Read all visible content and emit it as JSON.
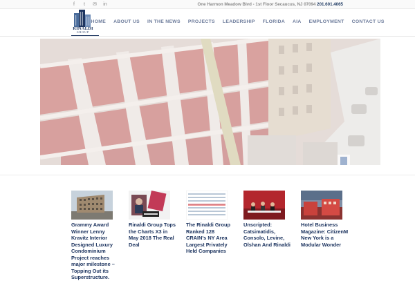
{
  "topbar": {
    "social": [
      {
        "icon": "facebook-icon",
        "glyph": "f"
      },
      {
        "icon": "twitter-icon",
        "glyph": "t"
      },
      {
        "icon": "mail-icon",
        "glyph": "✉"
      },
      {
        "icon": "linkedin-icon",
        "glyph": "in"
      }
    ],
    "address": "One Harmon Meadow Blvd - 1st Floor Secaucus, NJ 07094",
    "phone": "201.601.4065"
  },
  "header": {
    "logo_name": "RINALDI",
    "logo_sub": "GROUP",
    "nav": [
      {
        "label": "HOME",
        "name": "nav-home"
      },
      {
        "label": "ABOUT US",
        "name": "nav-about-us"
      },
      {
        "label": "IN THE NEWS",
        "name": "nav-in-the-news"
      },
      {
        "label": "PROJECTS",
        "name": "nav-projects"
      },
      {
        "label": "LEADERSHIP",
        "name": "nav-leadership"
      },
      {
        "label": "FLORIDA",
        "name": "nav-florida"
      },
      {
        "label": "AIA",
        "name": "nav-aia"
      },
      {
        "label": "EMPLOYMENT",
        "name": "nav-employment"
      },
      {
        "label": "CONTACT US",
        "name": "nav-contact-us"
      }
    ]
  },
  "news": [
    {
      "title": "Grammy Award Winner Lenny Kravitz Interior Designed Luxury Condominium Project reaches major milestone – Topping Out its Superstructure.",
      "thumb": "building-photo"
    },
    {
      "title": "Rinaldi Group Tops the Charts X3 in May 2018 The Real Deal",
      "thumb": "magazine-photo"
    },
    {
      "title": "The Rinaldi Group Ranked 128 CRAIN's NY Area Largest Privately Held Companies",
      "thumb": "ranking-list"
    },
    {
      "title": "Unscripted: Catsimatidis, Consolo, Levine, Olshan And Rinaldi",
      "thumb": "panel-photo"
    },
    {
      "title": "Hotel Business Magazine: CitizenM New York is a Modular Wonder",
      "thumb": "hotel-photo"
    }
  ],
  "colors": {
    "brand_navy": "#1e3560",
    "nav_text": "#6b7a9a",
    "hero_overlay": "#ffffff"
  }
}
